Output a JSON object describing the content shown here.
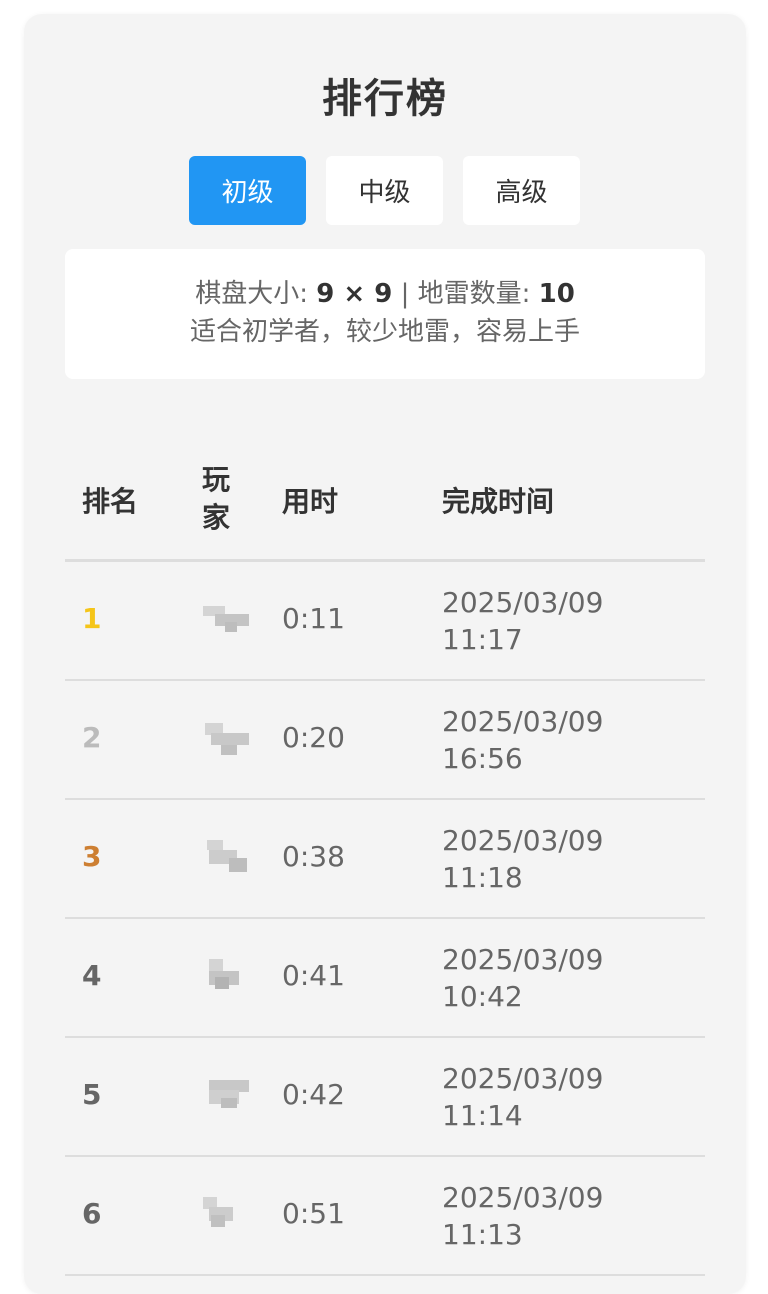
{
  "title": "排行榜",
  "tabs": [
    {
      "label": "初级",
      "active": true
    },
    {
      "label": "中级",
      "active": false
    },
    {
      "label": "高级",
      "active": false
    }
  ],
  "info": {
    "board_label": "棋盘大小:",
    "board_value": "9 × 9",
    "separator": " | ",
    "mines_label": "地雷数量:",
    "mines_value": "10",
    "description": "适合初学者，较少地雷，容易上手"
  },
  "table": {
    "headers": {
      "rank": "排名",
      "player": "玩家",
      "time": "用时",
      "completed": "完成时间"
    },
    "rows": [
      {
        "rank": "1",
        "time": "0:11",
        "date": "2025/03/09",
        "clock": "11:17"
      },
      {
        "rank": "2",
        "time": "0:20",
        "date": "2025/03/09",
        "clock": "16:56"
      },
      {
        "rank": "3",
        "time": "0:38",
        "date": "2025/03/09",
        "clock": "11:18"
      },
      {
        "rank": "4",
        "time": "0:41",
        "date": "2025/03/09",
        "clock": "10:42"
      },
      {
        "rank": "5",
        "time": "0:42",
        "date": "2025/03/09",
        "clock": "11:14"
      },
      {
        "rank": "6",
        "time": "0:51",
        "date": "2025/03/09",
        "clock": "11:13"
      }
    ]
  },
  "colors": {
    "accent": "#2196f3",
    "gold": "#f5c518",
    "silver": "#bbbbbb",
    "bronze": "#cd7f32",
    "default_rank": "#666666"
  }
}
